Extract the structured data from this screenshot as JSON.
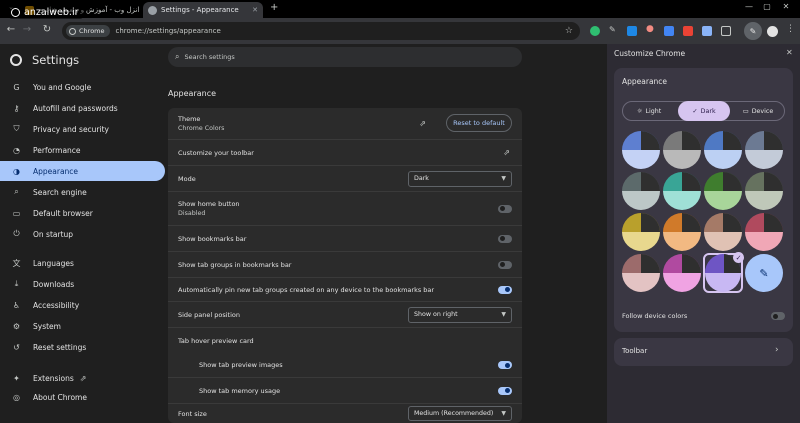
{
  "tabs": [
    {
      "title": "انزل وب - آموزش و وبعیبی هنایری",
      "active": false,
      "color": "#f9ab00"
    },
    {
      "title": "Settings - Appearance",
      "active": true,
      "color": "#9aa0a6"
    }
  ],
  "new_tab_icon": "plus-icon",
  "window_controls": [
    "minimize-icon",
    "maximize-icon",
    "close-icon"
  ],
  "omnibox": {
    "chip": "Chrome",
    "url": "chrome://settings/appearance"
  },
  "watermark": "anzalweb.ir",
  "settings": {
    "heading": "Settings",
    "search_placeholder": "Search settings",
    "nav": [
      {
        "label": "You and Google",
        "icon": "google-icon"
      },
      {
        "label": "Autofill and passwords",
        "icon": "key-icon"
      },
      {
        "label": "Privacy and security",
        "icon": "shield-icon"
      },
      {
        "label": "Performance",
        "icon": "speedometer-icon"
      },
      {
        "label": "Appearance",
        "icon": "palette-icon",
        "active": true
      },
      {
        "label": "Search engine",
        "icon": "search-icon"
      },
      {
        "label": "Default browser",
        "icon": "browser-icon"
      },
      {
        "label": "On startup",
        "icon": "power-icon"
      },
      {
        "label": "Languages",
        "icon": "translate-icon"
      },
      {
        "label": "Downloads",
        "icon": "download-icon"
      },
      {
        "label": "Accessibility",
        "icon": "accessibility-icon"
      },
      {
        "label": "System",
        "icon": "wrench-icon"
      },
      {
        "label": "Reset settings",
        "icon": "history-icon"
      },
      {
        "label": "Extensions",
        "icon": "puzzle-icon"
      },
      {
        "label": "About Chrome",
        "icon": "chrome-icon"
      }
    ],
    "section_title": "Appearance",
    "rows": {
      "theme_label": "Theme",
      "theme_value": "Chrome Colors",
      "reset_default": "Reset to default",
      "customize_toolbar": "Customize your toolbar",
      "mode_label": "Mode",
      "mode_value": "Dark",
      "home_button": "Show home button",
      "home_button_sub": "Disabled",
      "bookmarks_bar": "Show bookmarks bar",
      "tab_groups": "Show tab groups in bookmarks bar",
      "autopin": "Automatically pin new tab groups created on any device to the bookmarks bar",
      "side_panel_label": "Side panel position",
      "side_panel_value": "Show on right",
      "hover_card": "Tab hover preview card",
      "preview_images": "Show tab preview images",
      "memory_usage": "Show tab memory usage",
      "font_size_label": "Font size",
      "font_size_value": "Medium (Recommended)"
    },
    "toggles": {
      "home_button": false,
      "bookmarks_bar": false,
      "tab_groups": false,
      "autopin": true,
      "preview_images": true,
      "memory_usage": true
    }
  },
  "side_panel": {
    "title": "Customize Chrome",
    "appearance": "Appearance",
    "modes": [
      "Light",
      "Dark",
      "Device"
    ],
    "selected_mode": "Dark",
    "swatches": [
      [
        "#5e7fd0",
        "#c4d2f5"
      ],
      [
        "#7a7a7a",
        "#b9b9b9"
      ],
      [
        "#4f79c4",
        "#bcd0f3"
      ],
      [
        "#6c7a93",
        "#c3cbd8"
      ],
      [
        "#5c6a6b",
        "#bcc7c7"
      ],
      [
        "#39a596",
        "#9fe0d6"
      ],
      [
        "#3f7d2e",
        "#a8d59a"
      ],
      [
        "#66725f",
        "#bfc8b9"
      ],
      [
        "#b9a02c",
        "#e8d88e"
      ],
      [
        "#d07a2a",
        "#f2b982"
      ],
      [
        "#a57a67",
        "#e0c2b4"
      ],
      [
        "#b04a5e",
        "#f0a7b6"
      ],
      [
        "#9c6b6b",
        "#e3c3c3"
      ],
      [
        "#b04aa0",
        "#f0a3e3"
      ],
      [
        "#6e55c4",
        "#c8b8f3"
      ],
      [
        "#a8c7fa",
        "#a8c7fa"
      ]
    ],
    "selected_swatch": 14,
    "follow_device": "Follow device colors",
    "follow_device_on": false,
    "toolbar": "Toolbar"
  }
}
